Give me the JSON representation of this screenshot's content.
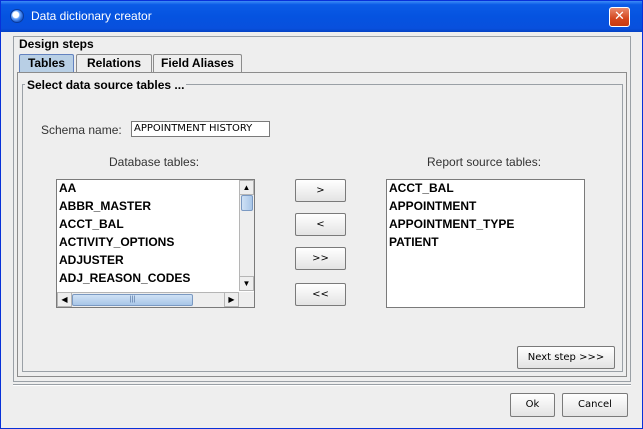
{
  "window": {
    "title": "Data dictionary creator",
    "close_glyph": "✕"
  },
  "design_steps": {
    "title": "Design steps"
  },
  "tabs": [
    {
      "label": "Tables",
      "active": true
    },
    {
      "label": "Relations",
      "active": false
    },
    {
      "label": "Field Aliases",
      "active": false
    }
  ],
  "panel": {
    "title": "Select data source tables ...",
    "schema_label": "Schema name:",
    "schema_value": "APPOINTMENT HISTORY",
    "database_tables_label": "Database tables:",
    "report_tables_label": "Report source tables:",
    "database_tables": [
      "AA",
      "ABBR_MASTER",
      "ACCT_BAL",
      "ACTIVITY_OPTIONS",
      "ADJUSTER",
      "ADJ_REASON_CODES"
    ],
    "report_tables": [
      "ACCT_BAL",
      "APPOINTMENT",
      "APPOINTMENT_TYPE",
      "PATIENT"
    ],
    "move_buttons": [
      ">",
      "<",
      ">>",
      "<<"
    ],
    "next_step": "Next step >>>"
  },
  "footer": {
    "ok": "Ok",
    "cancel": "Cancel"
  },
  "colors": {
    "titlebar": "#0553e0",
    "tab_active": "#b8cfe5",
    "background": "#eeeeee"
  }
}
